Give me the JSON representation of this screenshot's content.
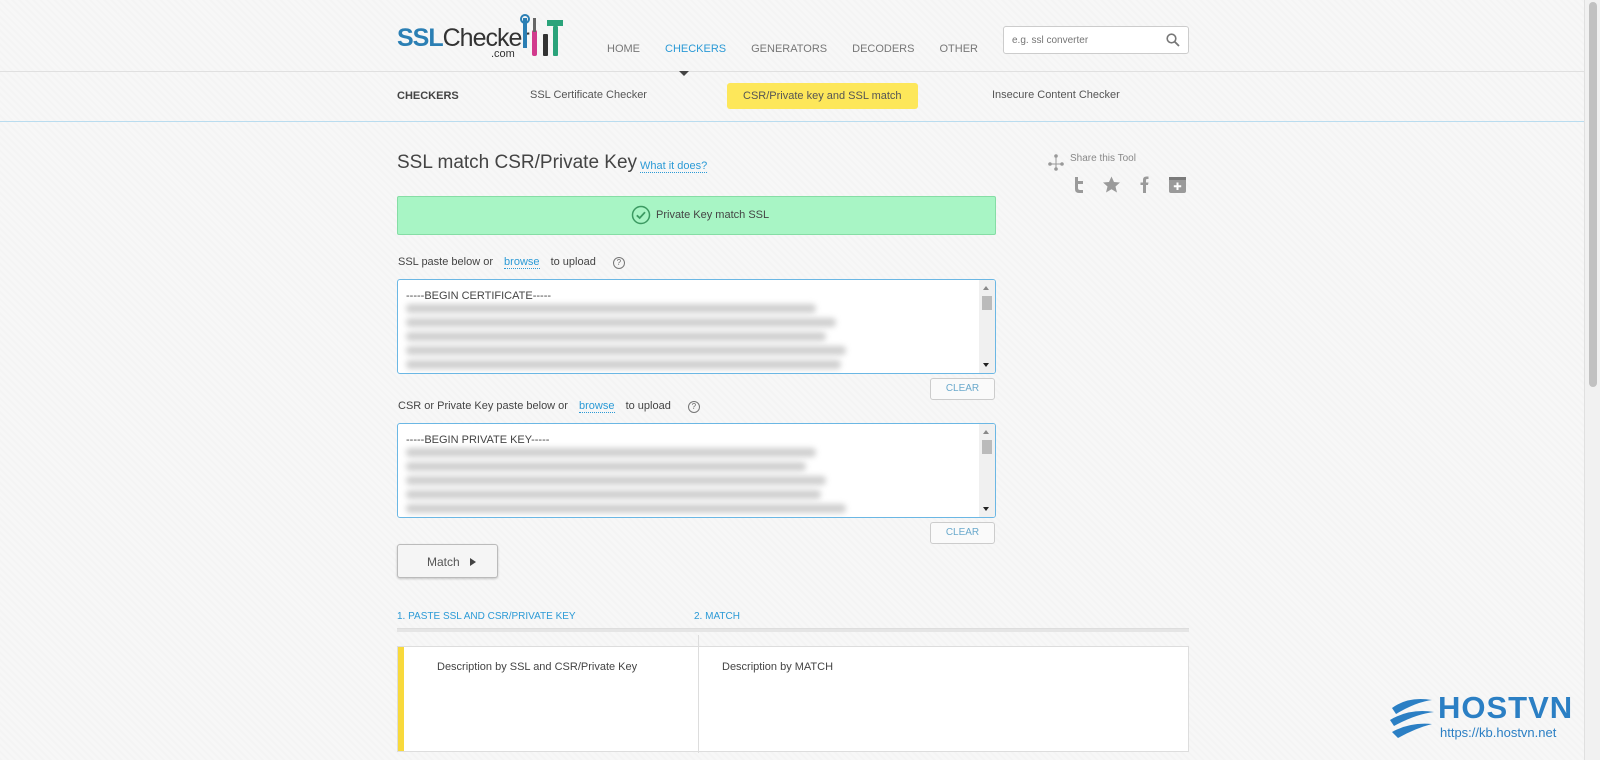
{
  "logo": {
    "ssl": "SSL",
    "checker": "Checker",
    "com": ".com"
  },
  "nav": {
    "items": [
      {
        "label": "HOME"
      },
      {
        "label": "CHECKERS"
      },
      {
        "label": "GENERATORS"
      },
      {
        "label": "DECODERS"
      },
      {
        "label": "OTHER"
      }
    ],
    "active_color": "#2b9ad6"
  },
  "search": {
    "placeholder": "e.g. ssl converter",
    "icon": "search-icon"
  },
  "subnav": {
    "title": "CHECKERS",
    "items": [
      {
        "label": "SSL Certificate Checker"
      },
      {
        "label": "CSR/Private key and SSL match"
      },
      {
        "label": "Insecure Content Checker"
      }
    ],
    "active_bg": "#fde75a"
  },
  "main": {
    "title": "SSL match CSR/Private Key",
    "what_link": "What it does?",
    "success": {
      "text": "Private Key match SSL",
      "icon": "check-circle-icon",
      "bg": "#a8f5c5"
    },
    "ssl_field": {
      "label_before": "SSL paste below or",
      "link": "browse",
      "label_after": "to upload",
      "help": "?",
      "first_line": "-----BEGIN CERTIFICATE-----",
      "clear": "CLEAR"
    },
    "key_field": {
      "label_before": "CSR or Private Key paste below or",
      "link": "browse",
      "label_after": "to upload",
      "help": "?",
      "first_line": "-----BEGIN PRIVATE KEY-----",
      "clear": "CLEAR"
    },
    "match_button": "Match",
    "steps": [
      {
        "label": "1. PASTE SSL AND CSR/PRIVATE KEY"
      },
      {
        "label": "2. MATCH"
      }
    ],
    "descriptions": [
      {
        "text": "Description by SSL and CSR/Private Key"
      },
      {
        "text": "Description by MATCH"
      }
    ]
  },
  "share": {
    "label": "Share this Tool",
    "icons": [
      "twitter-icon",
      "star-icon",
      "facebook-icon",
      "bookmark-plus-icon"
    ]
  },
  "watermark": {
    "brand": "HOSTVN",
    "url": "https://kb.hostvn.net"
  }
}
